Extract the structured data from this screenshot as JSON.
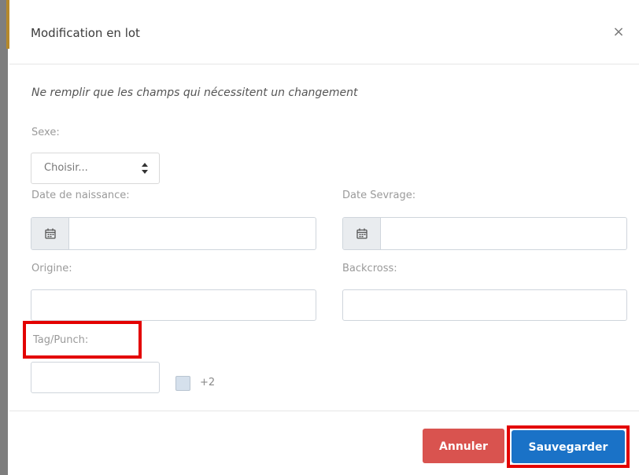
{
  "modal": {
    "title": "Modification en lot",
    "close_symbol": "×",
    "instruction": "Ne remplir que les champs qui nécessitent un changement"
  },
  "fields": {
    "sexe": {
      "label": "Sexe:",
      "selected": "Choisir..."
    },
    "date_naissance": {
      "label": "Date de naissance:",
      "value": "",
      "icon": "calendar-icon"
    },
    "date_sevrage": {
      "label": "Date Sevrage:",
      "value": "",
      "icon": "calendar-icon"
    },
    "origine": {
      "label": "Origine:",
      "value": ""
    },
    "backcross": {
      "label": "Backcross:",
      "value": ""
    },
    "tag_punch": {
      "label": "Tag/Punch:",
      "value": "",
      "checkbox_label": "+2",
      "checkbox_checked": false
    }
  },
  "footer": {
    "cancel_label": "Annuler",
    "save_label": "Sauvegarder"
  },
  "colors": {
    "cancel": "#d9534f",
    "save": "#1a72c7",
    "highlight": "#e30000"
  }
}
